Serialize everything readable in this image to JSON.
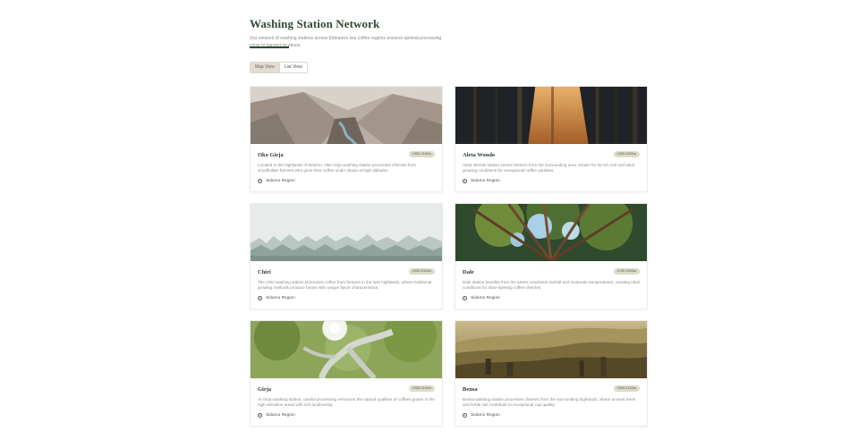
{
  "header": {
    "title": "Washing Station Network",
    "subtitle": "Our network of washing stations across Ethiopia's key coffee regions ensures optimal processing close to harvest locations."
  },
  "view_toggle": {
    "map_label": "Map View",
    "list_label": "List View",
    "selected": "Map View"
  },
  "stations": [
    {
      "name": "Oko Girja",
      "altitude": "1900-2100m",
      "description": "Located in the highlands of Sidamo, Oko Girja washing station processes cherries from smallholder farmers who grow their coffee under shade at high altitudes.",
      "region": "Sidamo Region",
      "image": "mountain-canyon"
    },
    {
      "name": "Aleta Wondo",
      "altitude": "1900-2000m",
      "description": "Aleta Wondo station serves farmers from the surrounding area, known for its rich soil and ideal growing conditions for exceptional coffee varieties.",
      "region": "Sidamo Region",
      "image": "forest-path-sunlight"
    },
    {
      "name": "Chiri",
      "altitude": "1900-2000m",
      "description": "The Chiri washing station processes coffee from farmers in the lush highlands, where traditional growing methods produce beans with unique flavor characteristics.",
      "region": "Sidamo Region",
      "image": "misty-forest"
    },
    {
      "name": "Dale",
      "altitude": "1750-1900m",
      "description": "Dale station benefits from the area's consistent rainfall and moderate temperatures, creating ideal conditions for slow-ripening coffee cherries.",
      "region": "Sidamo Region",
      "image": "tree-canopy"
    },
    {
      "name": "Girja",
      "altitude": "1900-2100m",
      "description": "At Girja washing station, careful processing enhances the natural qualities of coffees grown in the high elevation areas with rich biodiversity.",
      "region": "Sidamo Region",
      "image": "sunlit-tree"
    },
    {
      "name": "Bensa",
      "altitude": "1900-2100m",
      "description": "Bensa washing station processes cherries from the surrounding highlands, where ancient trees and fertile soil contribute to exceptional cup quality.",
      "region": "Sidamo Region",
      "image": "highland-valley"
    }
  ]
}
